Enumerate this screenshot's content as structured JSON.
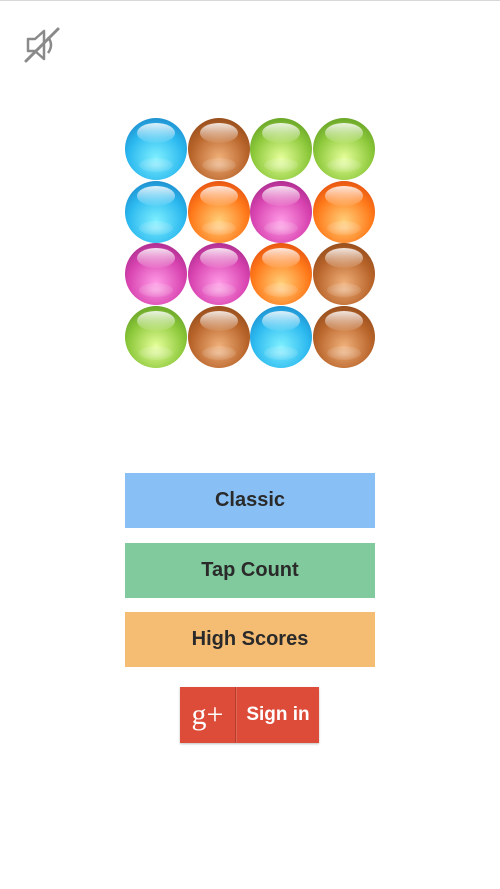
{
  "toolbar": {
    "mute_icon": "sound-off-icon"
  },
  "logo": {
    "rows": [
      [
        "blue",
        "brown",
        "green",
        "green"
      ],
      [
        "blue",
        "orange",
        "magenta",
        "orange"
      ],
      [
        "magenta",
        "magenta",
        "orange",
        "brown"
      ],
      [
        "green",
        "brown",
        "blue",
        "brown"
      ]
    ],
    "palette": {
      "blue": {
        "light": "#7ff0ff",
        "mid": "#2bb8ef",
        "dark": "#1572b8"
      },
      "brown": {
        "light": "#f0b07a",
        "mid": "#b8642a",
        "dark": "#7d3d12"
      },
      "green": {
        "light": "#e6ff9a",
        "mid": "#8cc83a",
        "dark": "#4e8a1a"
      },
      "orange": {
        "light": "#ffd07a",
        "mid": "#ff7a1a",
        "dark": "#d4380a"
      },
      "magenta": {
        "light": "#ff9be6",
        "mid": "#d843b0",
        "dark": "#8e1e78"
      }
    }
  },
  "menu": {
    "classic": {
      "label": "Classic",
      "color": "#88c0f5"
    },
    "tap_count": {
      "label": "Tap Count",
      "color": "#80ca9d"
    },
    "high_scores": {
      "label": "High Scores",
      "color": "#f5bc73"
    }
  },
  "signin": {
    "logo_text": "g+",
    "label": "Sign in",
    "color": "#dd4b39"
  }
}
